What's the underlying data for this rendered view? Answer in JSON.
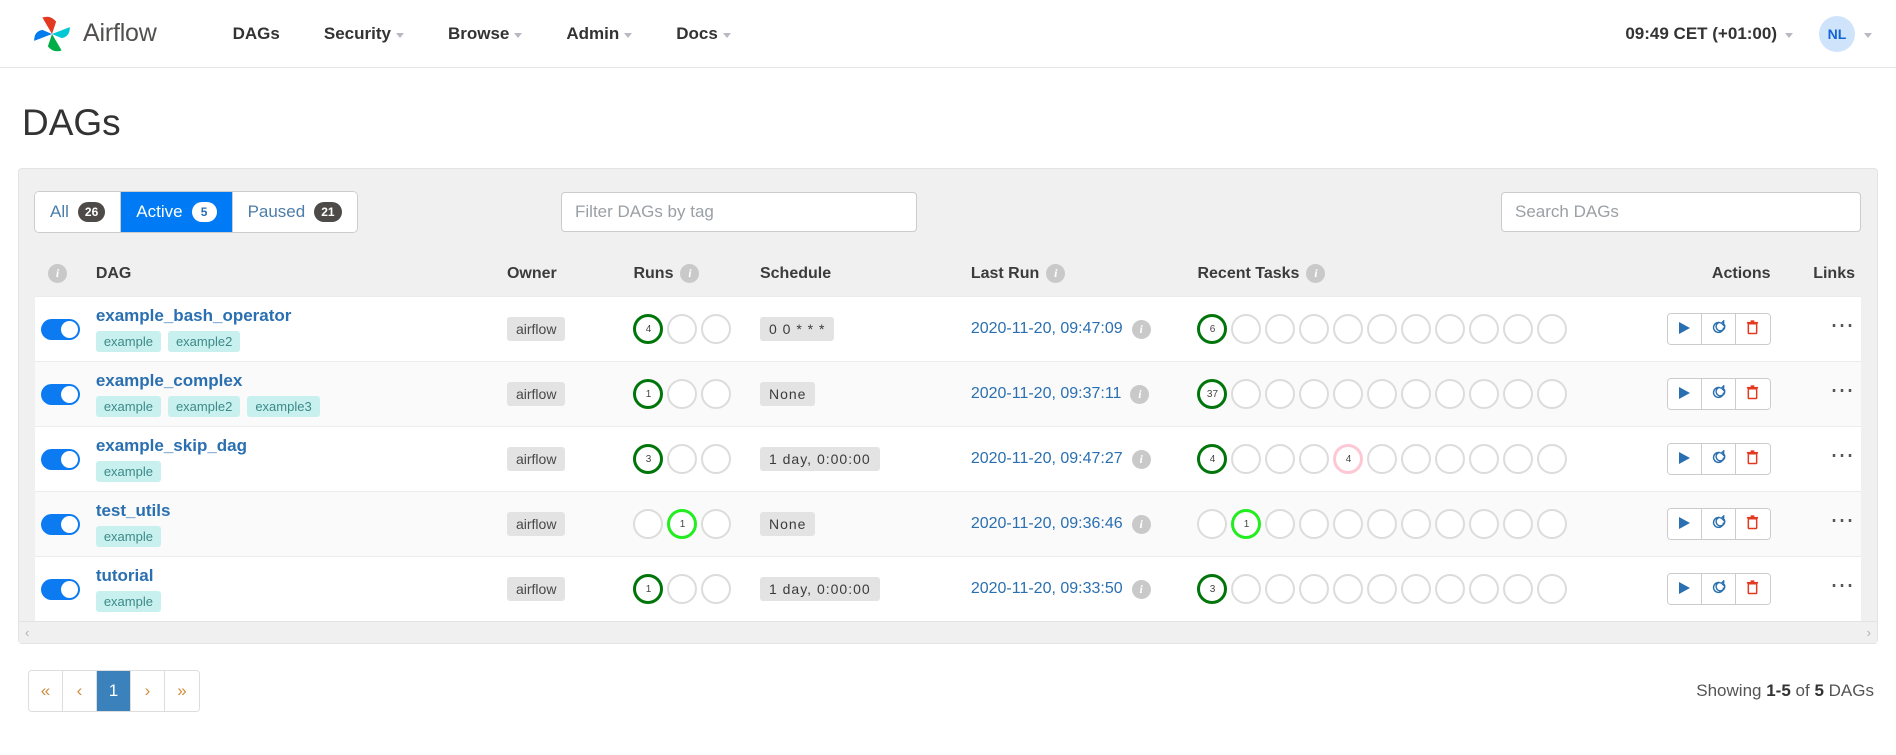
{
  "navbar": {
    "brand": "Airflow",
    "items": [
      {
        "label": "DAGs",
        "has_caret": false
      },
      {
        "label": "Security",
        "has_caret": true
      },
      {
        "label": "Browse",
        "has_caret": true
      },
      {
        "label": "Admin",
        "has_caret": true
      },
      {
        "label": "Docs",
        "has_caret": true
      }
    ],
    "clock": "09:49 CET (+01:00)",
    "avatar_initials": "NL"
  },
  "page": {
    "title": "DAGs"
  },
  "filters": {
    "tabs": [
      {
        "label": "All",
        "count": "26",
        "active": false
      },
      {
        "label": "Active",
        "count": "5",
        "active": true
      },
      {
        "label": "Paused",
        "count": "21",
        "active": false
      }
    ],
    "tag_placeholder": "Filter DAGs by tag",
    "search_placeholder": "Search DAGs"
  },
  "table": {
    "headers": {
      "toggle": "",
      "dag": "DAG",
      "owner": "Owner",
      "runs": "Runs",
      "schedule": "Schedule",
      "last_run": "Last Run",
      "recent_tasks": "Recent Tasks",
      "actions": "Actions",
      "links": "Links"
    },
    "rows": [
      {
        "paused": false,
        "name": "example_bash_operator",
        "tags": [
          "example",
          "example2"
        ],
        "owner": "airflow",
        "runs": [
          {
            "state": "success",
            "count": "4"
          },
          {
            "state": "none",
            "count": ""
          },
          {
            "state": "none",
            "count": ""
          }
        ],
        "schedule": "0 0 * * *",
        "last_run": "2020-11-20, 09:47:09",
        "recent_tasks": [
          {
            "state": "success",
            "count": "6"
          },
          {
            "state": "none",
            "count": ""
          },
          {
            "state": "none",
            "count": ""
          },
          {
            "state": "none",
            "count": ""
          },
          {
            "state": "none",
            "count": ""
          },
          {
            "state": "none",
            "count": ""
          },
          {
            "state": "none",
            "count": ""
          },
          {
            "state": "none",
            "count": ""
          },
          {
            "state": "none",
            "count": ""
          },
          {
            "state": "none",
            "count": ""
          },
          {
            "state": "none",
            "count": ""
          }
        ]
      },
      {
        "paused": false,
        "name": "example_complex",
        "tags": [
          "example",
          "example2",
          "example3"
        ],
        "owner": "airflow",
        "runs": [
          {
            "state": "success",
            "count": "1"
          },
          {
            "state": "none",
            "count": ""
          },
          {
            "state": "none",
            "count": ""
          }
        ],
        "schedule": "None",
        "last_run": "2020-11-20, 09:37:11",
        "recent_tasks": [
          {
            "state": "success",
            "count": "37"
          },
          {
            "state": "none",
            "count": ""
          },
          {
            "state": "none",
            "count": ""
          },
          {
            "state": "none",
            "count": ""
          },
          {
            "state": "none",
            "count": ""
          },
          {
            "state": "none",
            "count": ""
          },
          {
            "state": "none",
            "count": ""
          },
          {
            "state": "none",
            "count": ""
          },
          {
            "state": "none",
            "count": ""
          },
          {
            "state": "none",
            "count": ""
          },
          {
            "state": "none",
            "count": ""
          }
        ]
      },
      {
        "paused": false,
        "name": "example_skip_dag",
        "tags": [
          "example"
        ],
        "owner": "airflow",
        "runs": [
          {
            "state": "success",
            "count": "3"
          },
          {
            "state": "none",
            "count": ""
          },
          {
            "state": "none",
            "count": ""
          }
        ],
        "schedule": "1 day, 0:00:00",
        "last_run": "2020-11-20, 09:47:27",
        "recent_tasks": [
          {
            "state": "success",
            "count": "4"
          },
          {
            "state": "none",
            "count": ""
          },
          {
            "state": "none",
            "count": ""
          },
          {
            "state": "none",
            "count": ""
          },
          {
            "state": "skipped",
            "count": "4"
          },
          {
            "state": "none",
            "count": ""
          },
          {
            "state": "none",
            "count": ""
          },
          {
            "state": "none",
            "count": ""
          },
          {
            "state": "none",
            "count": ""
          },
          {
            "state": "none",
            "count": ""
          },
          {
            "state": "none",
            "count": ""
          }
        ]
      },
      {
        "paused": false,
        "name": "test_utils",
        "tags": [
          "example"
        ],
        "owner": "airflow",
        "runs": [
          {
            "state": "none",
            "count": ""
          },
          {
            "state": "running",
            "count": "1"
          },
          {
            "state": "none",
            "count": ""
          }
        ],
        "schedule": "None",
        "last_run": "2020-11-20, 09:36:46",
        "recent_tasks": [
          {
            "state": "none",
            "count": ""
          },
          {
            "state": "running",
            "count": "1"
          },
          {
            "state": "none",
            "count": ""
          },
          {
            "state": "none",
            "count": ""
          },
          {
            "state": "none",
            "count": ""
          },
          {
            "state": "none",
            "count": ""
          },
          {
            "state": "none",
            "count": ""
          },
          {
            "state": "none",
            "count": ""
          },
          {
            "state": "none",
            "count": ""
          },
          {
            "state": "none",
            "count": ""
          },
          {
            "state": "none",
            "count": ""
          }
        ]
      },
      {
        "paused": false,
        "name": "tutorial",
        "tags": [
          "example"
        ],
        "owner": "airflow",
        "runs": [
          {
            "state": "success",
            "count": "1"
          },
          {
            "state": "none",
            "count": ""
          },
          {
            "state": "none",
            "count": ""
          }
        ],
        "schedule": "1 day, 0:00:00",
        "last_run": "2020-11-20, 09:33:50",
        "recent_tasks": [
          {
            "state": "success",
            "count": "3"
          },
          {
            "state": "none",
            "count": ""
          },
          {
            "state": "none",
            "count": ""
          },
          {
            "state": "none",
            "count": ""
          },
          {
            "state": "none",
            "count": ""
          },
          {
            "state": "none",
            "count": ""
          },
          {
            "state": "none",
            "count": ""
          },
          {
            "state": "none",
            "count": ""
          },
          {
            "state": "none",
            "count": ""
          },
          {
            "state": "none",
            "count": ""
          },
          {
            "state": "none",
            "count": ""
          }
        ]
      }
    ],
    "action_icons": [
      "trigger-dag-icon",
      "refresh-dag-icon",
      "delete-dag-icon"
    ],
    "links_icon": "ellipsis-icon"
  },
  "footer": {
    "pagination": [
      {
        "label": "«",
        "name": "first-page",
        "active": false
      },
      {
        "label": "‹",
        "name": "prev-page",
        "active": false
      },
      {
        "label": "1",
        "name": "page-1",
        "active": true
      },
      {
        "label": "›",
        "name": "next-page",
        "active": false
      },
      {
        "label": "»",
        "name": "last-page",
        "active": false
      }
    ],
    "showing_prefix": "Showing",
    "showing_range": "1-5",
    "showing_mid": "of",
    "showing_total": "5",
    "showing_suffix": "DAGs"
  },
  "colors": {
    "accent": "#017cee",
    "success": "#00750a",
    "running": "#21ed21",
    "skipped": "#fdc7d4",
    "danger": "#e43921"
  }
}
